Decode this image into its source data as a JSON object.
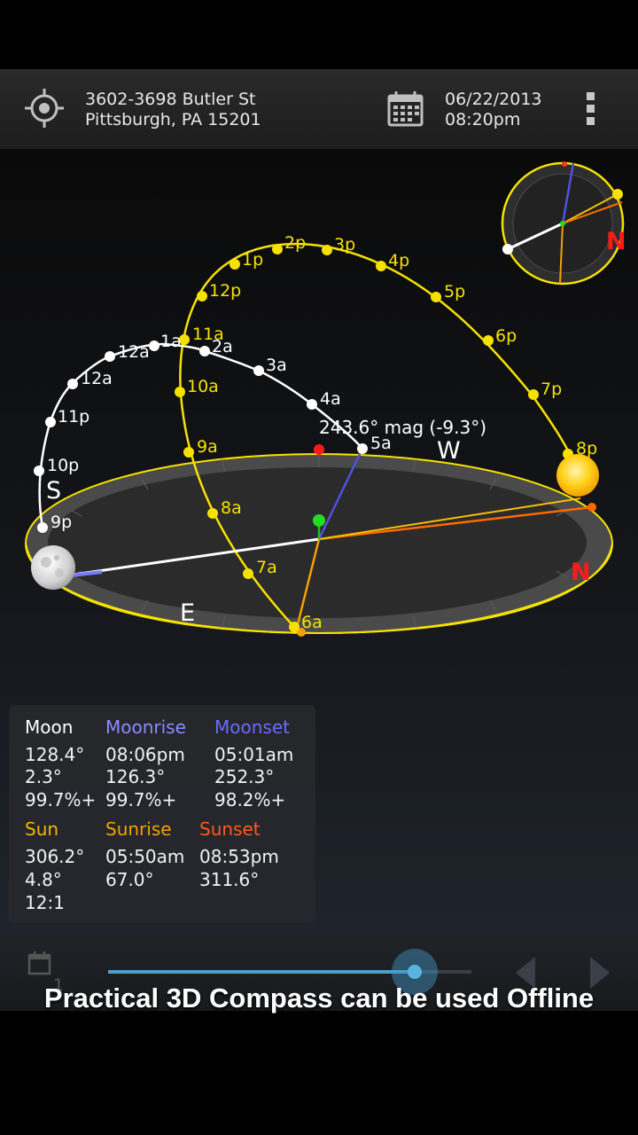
{
  "header": {
    "address_line1": "3602-3698 Butler St",
    "address_line2": "Pittsburgh, PA 15201",
    "date": "06/22/2013",
    "time": "08:20pm"
  },
  "scene": {
    "directions": {
      "south": "S",
      "west": "W",
      "east": "E",
      "north": "N",
      "mini_north": "N"
    },
    "moon_readout": "243.6° mag (-9.3°)",
    "sun_path_labels": [
      "6a",
      "7a",
      "8a",
      "9a",
      "10a",
      "11a",
      "12p",
      "1p",
      "2p",
      "3p",
      "4p",
      "5p",
      "6p",
      "7p",
      "8p"
    ],
    "moon_path_labels": [
      "9p",
      "10p",
      "11p",
      "12a",
      "12a",
      "1a",
      "2a",
      "3a",
      "4a",
      "5a"
    ]
  },
  "info": {
    "moon": {
      "title": "Moon",
      "azimuth": "128.4°",
      "altitude": "2.3°",
      "illumination": "99.7%+"
    },
    "moonrise": {
      "title": "Moonrise",
      "time": "08:06pm",
      "azimuth": "126.3°",
      "illumination": "99.7%+"
    },
    "moonset": {
      "title": "Moonset",
      "time": "05:01am",
      "azimuth": "252.3°",
      "illumination": "98.2%+"
    },
    "sun": {
      "title": "Sun",
      "azimuth": "306.2°",
      "altitude": "4.8°",
      "shadow_ratio": "12:1"
    },
    "sunrise": {
      "title": "Sunrise",
      "time": "05:50am",
      "azimuth": "67.0°"
    },
    "sunset": {
      "title": "Sunset",
      "time": "08:53pm",
      "azimuth": "311.6°"
    },
    "colors": {
      "moon_header": "#ffffff",
      "moonrise_header": "#8a8cff",
      "moonset_header": "#6a6cff",
      "sun_header": "#f5b400",
      "sunrise_header": "#f5a000",
      "sunset_header": "#ff5a1a"
    }
  },
  "timeline": {
    "step_label": "1",
    "slider_position": 0.845
  },
  "caption": "Practical 3D Compass can be used Offline",
  "colors": {
    "sun_path": "#f5e100",
    "moon_path": "#ffffff",
    "moon_line": "#5050e0",
    "sun_line": "#ff6a00",
    "north": "#ff1a1a"
  }
}
